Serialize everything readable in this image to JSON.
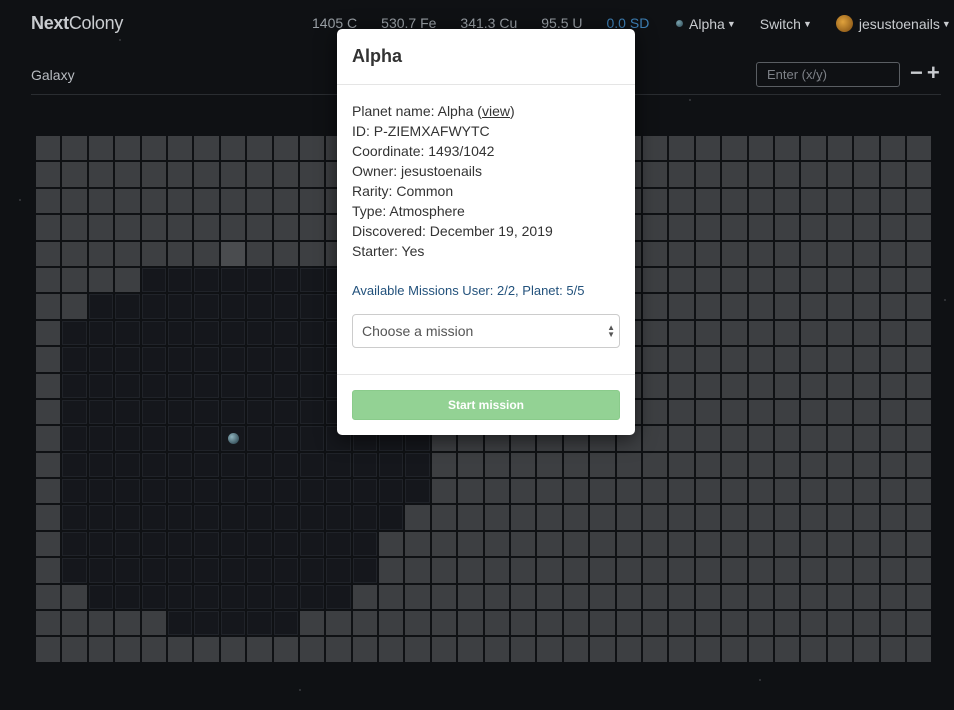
{
  "brand": {
    "bold": "Next",
    "regular": "Colony"
  },
  "resources": {
    "c": "1405 C",
    "fe": "530.7 Fe",
    "cu": "341.3 Cu",
    "u": "95.5 U",
    "sd": "0.0 SD"
  },
  "nav": {
    "planet": "Alpha",
    "switch": "Switch",
    "user": "jesustoenails"
  },
  "subbar": {
    "title": "Galaxy",
    "coord_placeholder": "Enter (x/y)",
    "zoom_out": "−",
    "zoom_in": "+"
  },
  "modal": {
    "title": "Alpha",
    "info": {
      "planet_name_prefix": "Planet name: Alpha (",
      "view_link": "view",
      "planet_name_suffix": ")",
      "id": "ID: P-ZIEMXAFWYTC",
      "coordinate": "Coordinate: 1493/1042",
      "owner": "Owner: jesustoenails",
      "rarity": "Rarity: Common",
      "type": "Type: Atmosphere",
      "discovered": "Discovered: December 19, 2019",
      "starter": "Starter: Yes"
    },
    "missions": "Available Missions User: 2/2, Planet: 5/5",
    "select_value": "Choose a mission",
    "start_button": "Start mission"
  },
  "colors": {
    "sd": "#3d7fb5",
    "missions_link": "#23527c",
    "start_button": "#93d294"
  },
  "icons": {
    "planet": "planet-icon",
    "avatar": "avatar-icon"
  }
}
